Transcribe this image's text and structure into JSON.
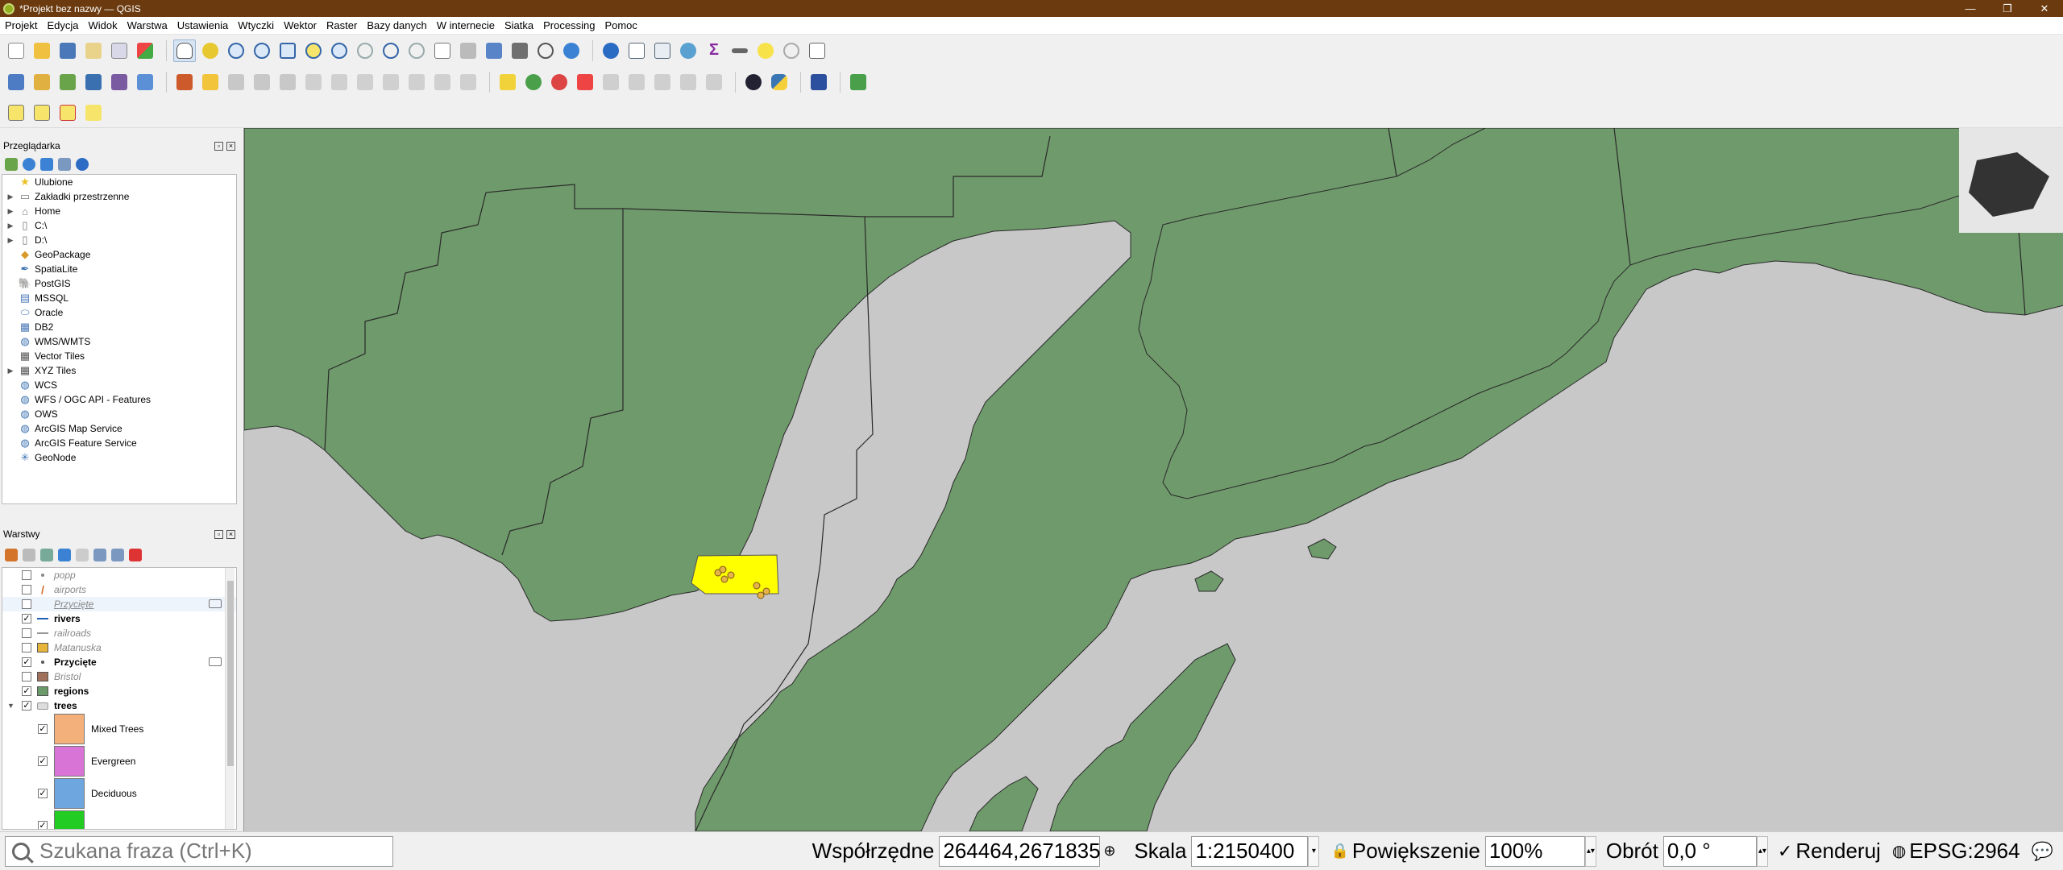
{
  "window": {
    "title": "*Projekt bez nazwy — QGIS",
    "minimize": "—",
    "maximize": "❐",
    "close": "✕"
  },
  "menu": [
    "Projekt",
    "Edycja",
    "Widok",
    "Warstwa",
    "Ustawienia",
    "Wtyczki",
    "Wektor",
    "Raster",
    "Bazy danych",
    "W internecie",
    "Siatka",
    "Processing",
    "Pomoc"
  ],
  "browser": {
    "title": "Przeglądarka",
    "items": [
      {
        "label": "Ulubione",
        "icon": "star-icon",
        "expand": false
      },
      {
        "label": "Zakładki przestrzenne",
        "icon": "bookmark-icon",
        "expand": true
      },
      {
        "label": "Home",
        "icon": "home-icon",
        "expand": true
      },
      {
        "label": "C:\\",
        "icon": "folder-icon",
        "expand": true
      },
      {
        "label": "D:\\",
        "icon": "folder-icon",
        "expand": true
      },
      {
        "label": "GeoPackage",
        "icon": "geopackage-icon",
        "expand": false
      },
      {
        "label": "SpatiaLite",
        "icon": "spatialite-icon",
        "expand": false
      },
      {
        "label": "PostGIS",
        "icon": "postgis-icon",
        "expand": false
      },
      {
        "label": "MSSQL",
        "icon": "mssql-icon",
        "expand": false
      },
      {
        "label": "Oracle",
        "icon": "oracle-icon",
        "expand": false
      },
      {
        "label": "DB2",
        "icon": "db2-icon",
        "expand": false
      },
      {
        "label": "WMS/WMTS",
        "icon": "wms-icon",
        "expand": false
      },
      {
        "label": "Vector Tiles",
        "icon": "vector-tiles-icon",
        "expand": false
      },
      {
        "label": "XYZ Tiles",
        "icon": "xyz-tiles-icon",
        "expand": true
      },
      {
        "label": "WCS",
        "icon": "wcs-icon",
        "expand": false
      },
      {
        "label": "WFS / OGC API - Features",
        "icon": "wfs-icon",
        "expand": false
      },
      {
        "label": "OWS",
        "icon": "ows-icon",
        "expand": false
      },
      {
        "label": "ArcGIS Map Service",
        "icon": "arcgis-map-icon",
        "expand": false
      },
      {
        "label": "ArcGIS Feature Service",
        "icon": "arcgis-feature-icon",
        "expand": false
      },
      {
        "label": "GeoNode",
        "icon": "geonode-icon",
        "expand": false
      }
    ]
  },
  "layers": {
    "title": "Warstwy",
    "items": [
      {
        "label": "popp",
        "checked": false,
        "visible": false,
        "sym": "dot",
        "color": "#888888"
      },
      {
        "label": "airports",
        "checked": false,
        "visible": false,
        "sym": "plane",
        "color": "#d06a2a"
      },
      {
        "label": "Przycięte",
        "checked": false,
        "visible": false,
        "sym": "none",
        "color": "#888888",
        "underline": true,
        "marker": true
      },
      {
        "label": "rivers",
        "checked": true,
        "visible": true,
        "sym": "line",
        "color": "#1f5fb4"
      },
      {
        "label": "railroads",
        "checked": false,
        "visible": false,
        "sym": "line",
        "color": "#999999"
      },
      {
        "label": "Matanuska",
        "checked": false,
        "visible": false,
        "sym": "fill",
        "color": "#e7b53a"
      },
      {
        "label": "Przycięte",
        "checked": true,
        "visible": true,
        "sym": "dot",
        "color": "#555555",
        "marker": true
      },
      {
        "label": "Bristol",
        "checked": false,
        "visible": false,
        "sym": "fill",
        "color": "#a0705a"
      },
      {
        "label": "regions",
        "checked": true,
        "visible": true,
        "sym": "fill",
        "color": "#6a9a6a"
      },
      {
        "label": "trees",
        "checked": true,
        "visible": true,
        "sym": "raster",
        "color": "#aaaaaa",
        "expanded": true
      }
    ],
    "legend": [
      {
        "label": "Mixed Trees",
        "color": "#f4b07a",
        "checked": true
      },
      {
        "label": "Evergreen",
        "color": "#d874d6",
        "checked": true
      },
      {
        "label": "Deciduous",
        "color": "#6ea6df",
        "checked": true
      },
      {
        "label": "",
        "color": "#22cc22",
        "checked": true
      }
    ]
  },
  "colors": {
    "land": "#6f9a6b",
    "water": "#c8c8c8",
    "selected": "#ffff00",
    "boundary": "#2a2a2a",
    "titlebar": "#6b3a0e"
  },
  "status": {
    "search_placeholder": "Szukana fraza (Ctrl+K)",
    "coords_label": "Współrzędne",
    "coords_value": "264464,2671835",
    "scale_label": "Skala",
    "scale_value": "1:2150400",
    "zoom_label": "Powiększenie",
    "zoom_value": "100%",
    "rotation_label": "Obrót",
    "rotation_value": "0,0 °",
    "render_label": "Renderuj",
    "render_checked": "✓",
    "crs_label": "EPSG:2964"
  }
}
